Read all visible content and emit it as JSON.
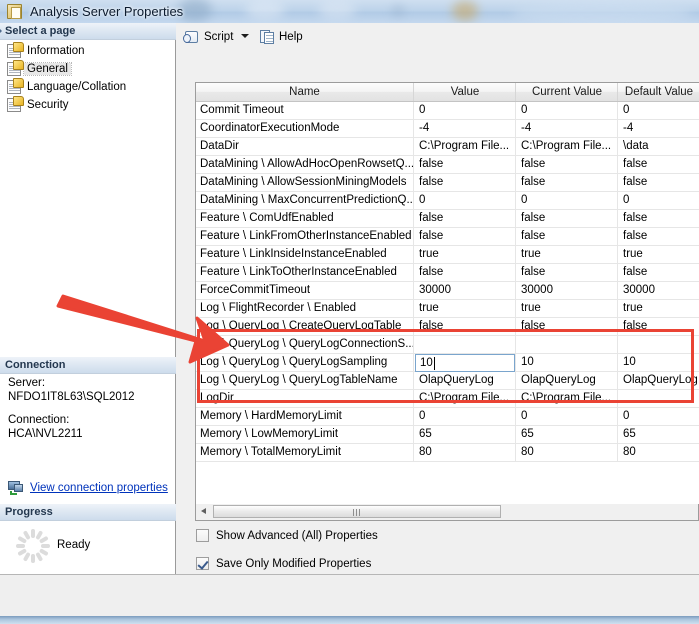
{
  "window": {
    "title": "Analysis Server Properties",
    "title_icon": "properties-window-icon"
  },
  "left_pane": {
    "select_page_header": "Select a page",
    "pages": [
      {
        "label": "Information",
        "selected": false,
        "icon": "page-icon"
      },
      {
        "label": "General",
        "selected": true,
        "icon": "page-icon"
      },
      {
        "label": "Language/Collation",
        "selected": false,
        "icon": "page-icon"
      },
      {
        "label": "Security",
        "selected": false,
        "icon": "page-icon"
      }
    ],
    "connection": {
      "header": "Connection",
      "server_label": "Server:",
      "server_value": "NFDO1IT8L63\\SQL2012",
      "connection_label": "Connection:",
      "connection_value": "HCA\\NVL2211",
      "link_text": "View connection properties",
      "link_icon": "connection-properties-icon"
    },
    "progress": {
      "header": "Progress",
      "status": "Ready",
      "spinner_icon": "progress-spinner-icon"
    }
  },
  "toolbar": {
    "script_label": "Script",
    "script_icon": "script-icon",
    "script_dropdown_icon": "chevron-down-icon",
    "help_label": "Help",
    "help_icon": "help-icon"
  },
  "grid": {
    "columns": [
      "Name",
      "Value",
      "Current Value",
      "Default Value"
    ],
    "rows": [
      {
        "name": "Commit Timeout",
        "value": "0",
        "current": "0",
        "default": "0"
      },
      {
        "name": "CoordinatorExecutionMode",
        "value": "-4",
        "current": "-4",
        "default": "-4"
      },
      {
        "name": "DataDir",
        "value": "C:\\Program File...",
        "current": "C:\\Program File...",
        "default": "\\data"
      },
      {
        "name": "DataMining \\ AllowAdHocOpenRowsetQ...",
        "value": "false",
        "current": "false",
        "default": "false"
      },
      {
        "name": "DataMining \\ AllowSessionMiningModels",
        "value": "false",
        "current": "false",
        "default": "false"
      },
      {
        "name": "DataMining \\ MaxConcurrentPredictionQ...",
        "value": "0",
        "current": "0",
        "default": "0"
      },
      {
        "name": "Feature \\ ComUdfEnabled",
        "value": "false",
        "current": "false",
        "default": "false"
      },
      {
        "name": "Feature \\ LinkFromOtherInstanceEnabled",
        "value": "false",
        "current": "false",
        "default": "false"
      },
      {
        "name": "Feature \\ LinkInsideInstanceEnabled",
        "value": "true",
        "current": "true",
        "default": "true"
      },
      {
        "name": "Feature \\ LinkToOtherInstanceEnabled",
        "value": "false",
        "current": "false",
        "default": "false"
      },
      {
        "name": "ForceCommitTimeout",
        "value": "30000",
        "current": "30000",
        "default": "30000"
      },
      {
        "name": "Log \\ FlightRecorder \\ Enabled",
        "value": "true",
        "current": "true",
        "default": "true"
      },
      {
        "name": "Log \\ QueryLog \\ CreateQueryLogTable",
        "value": "false",
        "current": "false",
        "default": "false"
      },
      {
        "name": "Log \\ QueryLog \\ QueryLogConnectionS...",
        "value": "",
        "current": "",
        "default": ""
      },
      {
        "name": "Log \\ QueryLog \\ QueryLogSampling",
        "value": "10",
        "current": "10",
        "default": "10",
        "editing": true
      },
      {
        "name": "Log \\ QueryLog \\ QueryLogTableName",
        "value": "OlapQueryLog",
        "current": "OlapQueryLog",
        "default": "OlapQueryLog"
      },
      {
        "name": "LogDir",
        "value": "C:\\Program File...",
        "current": "C:\\Program File...",
        "default": ""
      },
      {
        "name": "Memory \\ HardMemoryLimit",
        "value": "0",
        "current": "0",
        "default": "0"
      },
      {
        "name": "Memory \\ LowMemoryLimit",
        "value": "65",
        "current": "65",
        "default": "65"
      },
      {
        "name": "Memory \\ TotalMemoryLimit",
        "value": "80",
        "current": "80",
        "default": "80"
      }
    ],
    "editing_cell_value": "10",
    "scrollbar": {
      "left_arrow_icon": "scroll-left-icon",
      "grip_icon": "scroll-grip-icon"
    }
  },
  "options": {
    "show_advanced_label": "Show Advanced (All) Properties",
    "show_advanced_checked": false,
    "save_only_modified_label": "Save Only Modified Properties",
    "save_only_modified_checked": true
  },
  "annotations": {
    "highlight_color": "#ea4334",
    "arrow_icon": "red-pointer-arrow",
    "box_icon": "red-highlight-box"
  }
}
